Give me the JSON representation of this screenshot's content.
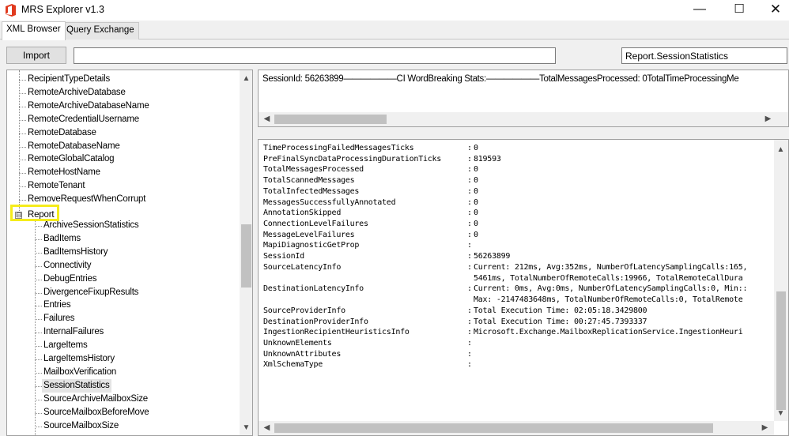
{
  "window": {
    "title": "MRS Explorer v1.3",
    "minimize_glyph": "—",
    "maximize_glyph": "☐",
    "close_glyph": "✕"
  },
  "tabs": [
    {
      "label": "XML Browser",
      "active": true
    },
    {
      "label": "Query Exchange",
      "active": false
    }
  ],
  "toolbar": {
    "import_label": "Import",
    "path_value": "",
    "report_value": "Report.SessionStatistics"
  },
  "tree": {
    "top_items": [
      "RecipientTypeDetails",
      "RemoteArchiveDatabase",
      "RemoteArchiveDatabaseName",
      "RemoteCredentialUsername",
      "RemoteDatabase",
      "RemoteDatabaseName",
      "RemoteGlobalCatalog",
      "RemoteHostName",
      "RemoteTenant",
      "RemoveRequestWhenCorrupt"
    ],
    "report_node": {
      "label": "Report",
      "expander_glyph": "⊟"
    },
    "report_children": [
      "ArchiveSessionStatistics",
      "BadItems",
      "BadItemsHistory",
      "Connectivity",
      "DebugEntries",
      "DivergenceFixupResults",
      "Entries",
      "Failures",
      "InternalFailures",
      "LargeItems",
      "LargeItemsHistory",
      "MailboxVerification",
      "SessionStatistics",
      "SourceArchiveMailboxSize",
      "SourceMailboxBeforeMove",
      "SourceMailboxSize"
    ],
    "selected_item": "SessionStatistics"
  },
  "summary": {
    "text": "SessionId: 56263899——————CI WordBreaking Stats:——————TotalMessagesProcessed: 0TotalTimeProcessingMe"
  },
  "details": {
    "rows": [
      {
        "key": "TimeProcessingFailedMessagesTicks",
        "value": "0"
      },
      {
        "key": "PreFinalSyncDataProcessingDurationTicks",
        "value": "819593"
      },
      {
        "key": "TotalMessagesProcessed",
        "value": "0"
      },
      {
        "key": "TotalScannedMessages",
        "value": "0"
      },
      {
        "key": "TotalInfectedMessages",
        "value": "0"
      },
      {
        "key": "MessagesSuccessfullyAnnotated",
        "value": "0"
      },
      {
        "key": "AnnotationSkipped",
        "value": "0"
      },
      {
        "key": "ConnectionLevelFailures",
        "value": "0"
      },
      {
        "key": "MessageLevelFailures",
        "value": "0"
      },
      {
        "key": "MapiDiagnosticGetProp",
        "value": ""
      },
      {
        "key": "SessionId",
        "value": "56263899"
      },
      {
        "key": "SourceLatencyInfo",
        "value": "Current: 212ms, Avg:352ms, NumberOfLatencySamplingCalls:165,"
      },
      {
        "key": "",
        "value": "5461ms, TotalNumberOfRemoteCalls:19966, TotalRemoteCallDura"
      },
      {
        "key": "DestinationLatencyInfo",
        "value": "Current: 0ms, Avg:0ms, NumberOfLatencySamplingCalls:0, Min::"
      },
      {
        "key": "",
        "value": "Max: -2147483648ms, TotalNumberOfRemoteCalls:0, TotalRemote"
      },
      {
        "key": "SourceProviderInfo",
        "value": "Total Execution Time: 02:05:18.3429800"
      },
      {
        "key": "DestinationProviderInfo",
        "value": "Total Execution Time: 00:27:45.7393337"
      },
      {
        "key": "IngestionRecipientHeuristicsInfo",
        "value": "Microsoft.Exchange.MailboxReplicationService.IngestionHeuri"
      },
      {
        "key": "UnknownElements",
        "value": ""
      },
      {
        "key": "UnknownAttributes",
        "value": ""
      },
      {
        "key": "XmlSchemaType",
        "value": ""
      }
    ]
  },
  "scroll_glyphs": {
    "up": "▲",
    "down": "▼",
    "left": "◀",
    "right": "▶"
  }
}
